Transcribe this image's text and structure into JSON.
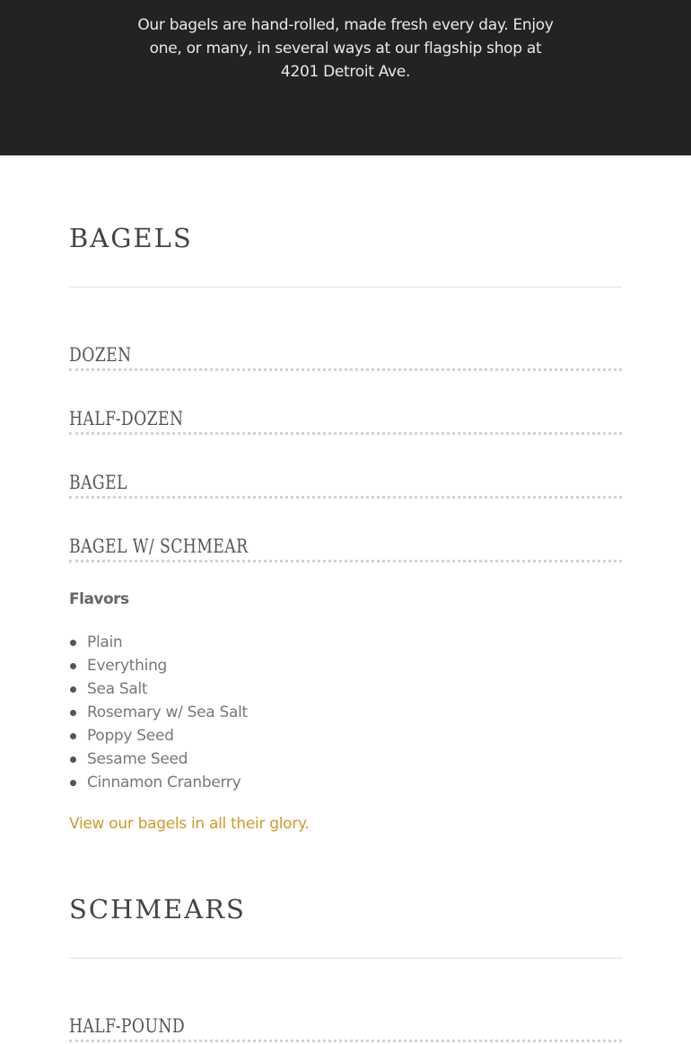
{
  "hero": {
    "intro": "Our bagels are hand-rolled, made fresh every day. Enjoy one, or many, in several ways at our flagship shop at 4201 Detroit Ave."
  },
  "bagels": {
    "title": "BAGELS",
    "items": [
      "DOZEN",
      "HALF-DOZEN",
      "BAGEL",
      "BAGEL W/ SCHMEAR"
    ],
    "flavors_heading": "Flavors",
    "flavors": [
      "Plain",
      "Everything",
      "Sea Salt",
      "Rosemary w/ Sea Salt",
      "Poppy Seed",
      "Sesame Seed",
      "Cinnamon Cranberry"
    ],
    "link": "View our bagels in all their glory."
  },
  "schmears": {
    "title": "SCHMEARS",
    "items": [
      "HALF-POUND"
    ]
  },
  "colors": {
    "hero_bg": "#232323",
    "link": "#d19a2a",
    "rule": "#e2e2e2"
  }
}
